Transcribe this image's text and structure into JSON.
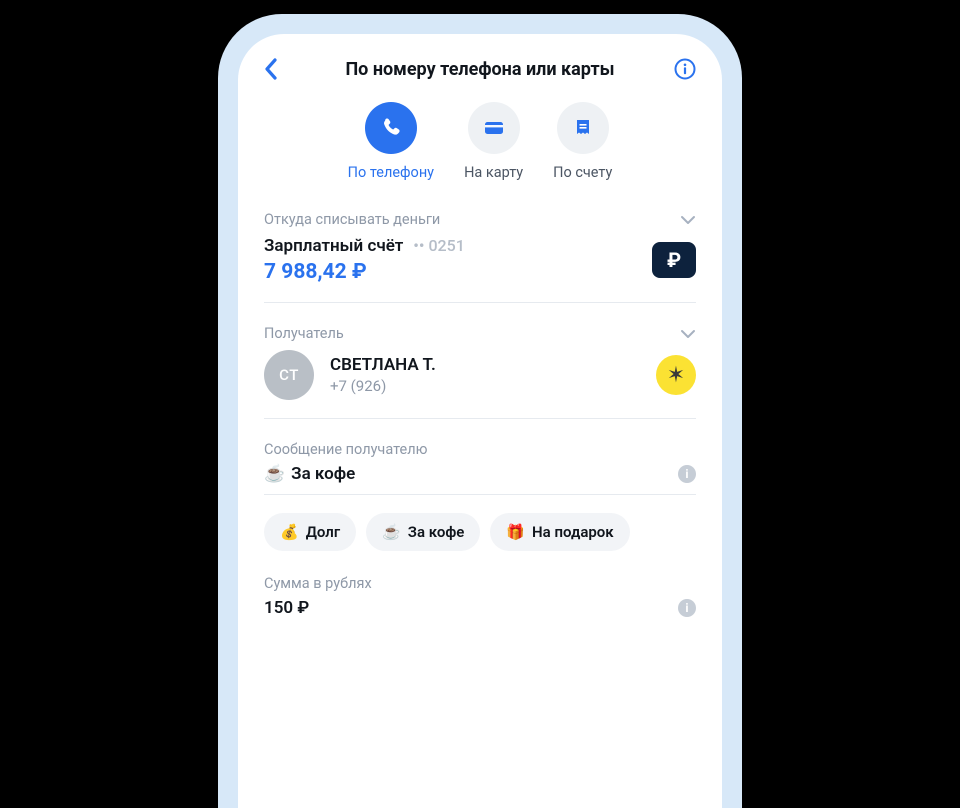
{
  "header": {
    "title": "По номеру телефона или карты"
  },
  "methods": [
    {
      "label": "По телефону",
      "active": true
    },
    {
      "label": "На карту",
      "active": false
    },
    {
      "label": "По счету",
      "active": false
    }
  ],
  "source": {
    "section_label": "Откуда списывать деньги",
    "name": "Зарплатный счёт",
    "mask": "•• 0251",
    "balance": "7 988,42 ₽",
    "currency_badge": "₽"
  },
  "recipient": {
    "section_label": "Получатель",
    "initials": "СТ",
    "name": "СВЕТЛАНА Т.",
    "phone": "+7 (926)"
  },
  "message": {
    "section_label": "Сообщение получателю",
    "emoji": "☕",
    "text": "За кофе"
  },
  "chips": [
    {
      "emoji": "💰",
      "label": "Долг"
    },
    {
      "emoji": "☕",
      "label": "За кофе"
    },
    {
      "emoji": "🎁",
      "label": "На подарок"
    }
  ],
  "amount": {
    "section_label": "Сумма в рублях",
    "value": "150 ₽"
  },
  "colors": {
    "accent": "#2a72ee",
    "muted": "#8e98a7",
    "chip_bg": "#f2f4f7",
    "badge_dark": "#0d223d",
    "bank_badge": "#fbe233"
  }
}
